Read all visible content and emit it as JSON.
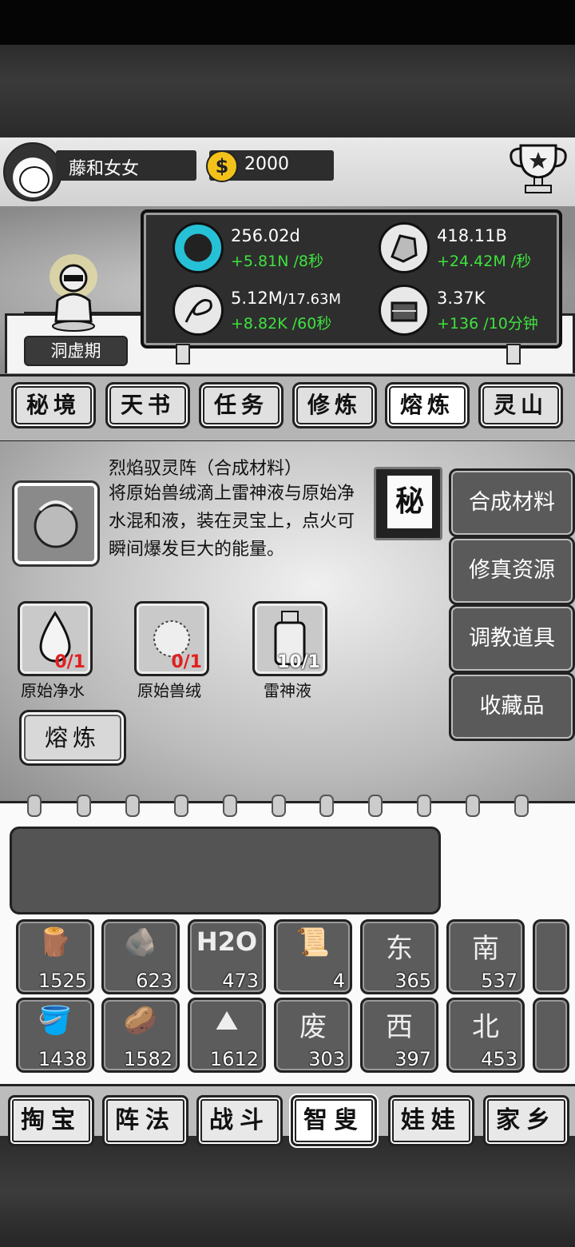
{
  "player": {
    "name": "藤和女女",
    "coins": "2000",
    "realm": "洞虚期"
  },
  "stats": [
    {
      "icon": "tadpole-essence-icon",
      "value": "256.02d",
      "rate": "+5.81N /8秒"
    },
    {
      "icon": "crystal-stone-icon",
      "value": "418.11B",
      "rate": "+24.42M /秒"
    },
    {
      "icon": "whirlwind-icon",
      "value": "5.12M",
      "max": "/17.63M",
      "rate": "+8.82K /60秒"
    },
    {
      "icon": "treasure-chest-icon",
      "value": "3.37K",
      "rate": "+136 /10分钟"
    }
  ],
  "tabs": [
    "秘境",
    "天书",
    "任务",
    "修炼",
    "熔炼",
    "灵山"
  ],
  "active_tab": "熔炼",
  "recipe": {
    "title": "烈焰驭灵阵（合成材料）",
    "description": "将原始兽绒滴上雷神液与原始净水混和液，装在灵宝上，点火可瞬间爆发巨大的能量。",
    "secret_label": "秘",
    "materials": [
      {
        "icon": "water-drop-icon",
        "count": "0/1",
        "name": "原始净水",
        "status": "missing"
      },
      {
        "icon": "fur-ball-icon",
        "count": "0/1",
        "name": "原始兽绒",
        "status": "missing"
      },
      {
        "icon": "bottle-icon",
        "count": "10/1",
        "name": "雷神液",
        "status": "ok"
      }
    ],
    "smelt_label": "熔炼"
  },
  "categories": [
    "合成材料",
    "修真资源",
    "调教道具",
    "收藏品"
  ],
  "inventory": [
    [
      {
        "icon": "wood-bundle-icon",
        "glyph": "🪵",
        "count": "1525"
      },
      {
        "icon": "rock-pile-icon",
        "glyph": "🪨",
        "count": "623"
      },
      {
        "icon": "h2o-icon",
        "glyph": "H2O",
        "count": "473"
      },
      {
        "icon": "scroll-icon",
        "glyph": "📜",
        "count": "4"
      },
      {
        "icon": "east-doll-icon",
        "glyph": "东",
        "count": "365"
      },
      {
        "icon": "south-doll-icon",
        "glyph": "南",
        "count": "537"
      }
    ],
    [
      {
        "icon": "stump-icon",
        "glyph": "🪣",
        "count": "1438"
      },
      {
        "icon": "spotted-stone-icon",
        "glyph": "🥔",
        "count": "1582"
      },
      {
        "icon": "sand-pile-icon",
        "glyph": "⛰",
        "count": "1612"
      },
      {
        "icon": "waste-bag-icon",
        "glyph": "废",
        "count": "303"
      },
      {
        "icon": "west-doll-icon",
        "glyph": "西",
        "count": "397"
      },
      {
        "icon": "north-doll-icon",
        "glyph": "北",
        "count": "453"
      }
    ]
  ],
  "bottom_nav": [
    "掏宝",
    "阵法",
    "战斗",
    "智叟",
    "娃娃",
    "家乡"
  ],
  "active_nav": "智叟"
}
